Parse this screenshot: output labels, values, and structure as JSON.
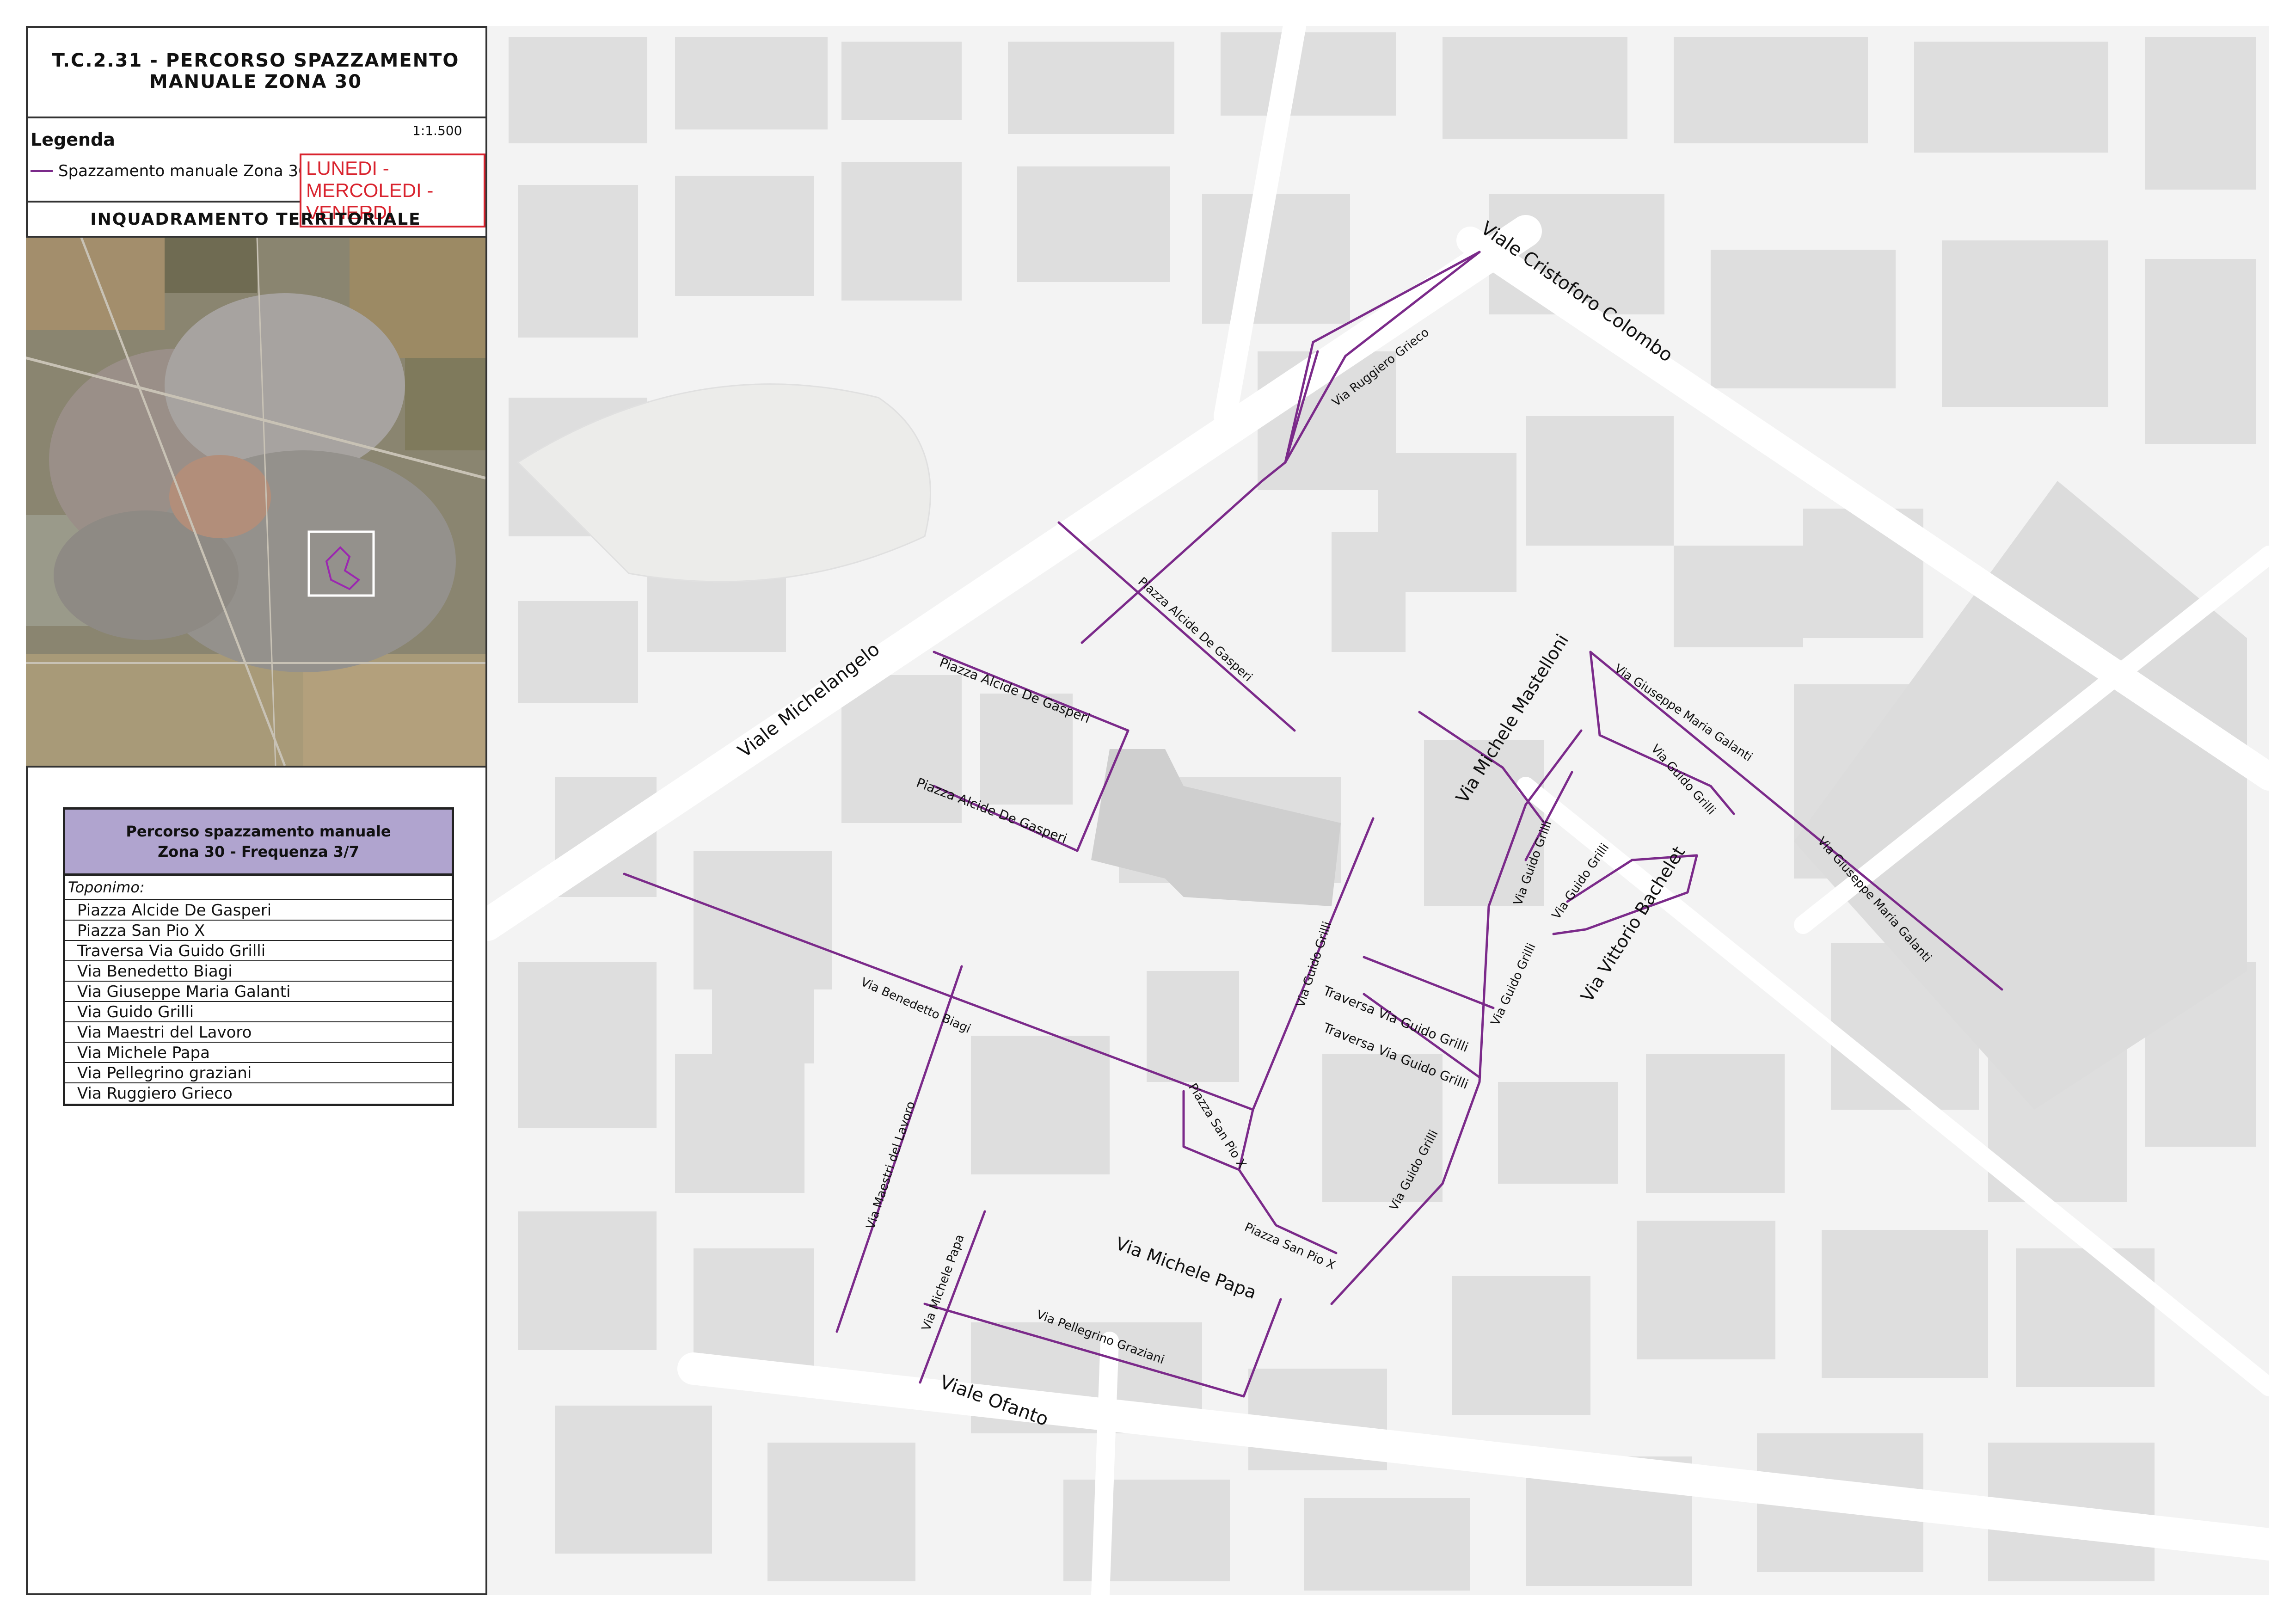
{
  "title": {
    "line1": "T.C.2.31 - PERCORSO SPAZZAMENTO",
    "line2": "MANUALE ZONA 30"
  },
  "legend": {
    "heading": "Legenda",
    "scale": "1:1.500",
    "item_label": "Spazzamento manuale Zona 30",
    "days": "LUNEDI - MERCOLEDI - VENERDI",
    "route_color": "#7b2a8a",
    "days_color": "#d9232e"
  },
  "inquadramento": {
    "heading": "INQUADRAMENTO TERRITORIALE"
  },
  "table": {
    "header_line1": "Percorso spazzamento  manuale",
    "header_line2": "Zona 30 - Frequenza 3/7",
    "subheader": "Toponimo:",
    "header_color": "#b0a4cf",
    "rows": [
      "Piazza Alcide De Gasperi",
      "Piazza San Pio X",
      "Traversa Via Guido Grilli",
      "Via Benedetto Biagi",
      "Via Giuseppe Maria Galanti",
      "Via Guido Grilli",
      "Via Maestri del Lavoro",
      "Via Michele Papa",
      "Via Pellegrino graziani",
      "Via Ruggiero Grieco"
    ]
  },
  "map_labels": {
    "viale_cristoforo_colombo": "Viale Cristoforo Colombo",
    "via_ruggiero_grieco": "Via Ruggiero Grieco",
    "piazza_de_gasperi_1": "Piazza Alcide De Gasperi",
    "piazza_de_gasperi_2": "Piazza Alcide De Gasperi",
    "piazza_de_gasperi_3": "Piazza Alcide De Gasperi",
    "viale_michelangelo": "Viale Michelangelo",
    "via_michele_mastelloni": "Via Michele Mastelloni",
    "via_galanti_1": "Via Giuseppe Maria Galanti",
    "via_galanti_2": "Via Giuseppe Maria Galanti",
    "via_guido_grilli_1": "Via Guido Grilli",
    "via_guido_grilli_2": "Via Guido Grilli",
    "via_guido_grilli_3": "Via Guido Grilli",
    "via_guido_grilli_4": "Via Guido Grilli",
    "via_guido_grilli_5": "Via Guido Grilli",
    "via_guido_grilli_6": "Via Guido Grilli",
    "via_vittorio_bachelet": "Via Vittorio Bachelet",
    "traversa_grilli_1": "Traversa Via Guido Grilli",
    "traversa_grilli_2": "Traversa Via Guido Grilli",
    "via_benedetto_biagi": "Via Benedetto Biagi",
    "piazza_san_pio_1": "Piazza San Pio X",
    "piazza_san_pio_2": "Piazza San Pio X",
    "via_maestri_del_lavoro": "Via Maestri del Lavoro",
    "via_michele_papa_1": "Via Michele Papa",
    "via_michele_papa_2": "Via Michele Papa",
    "via_pellegrino_graziani": "Via Pellegrino Graziani",
    "viale_ofanto": "Viale Ofanto"
  }
}
